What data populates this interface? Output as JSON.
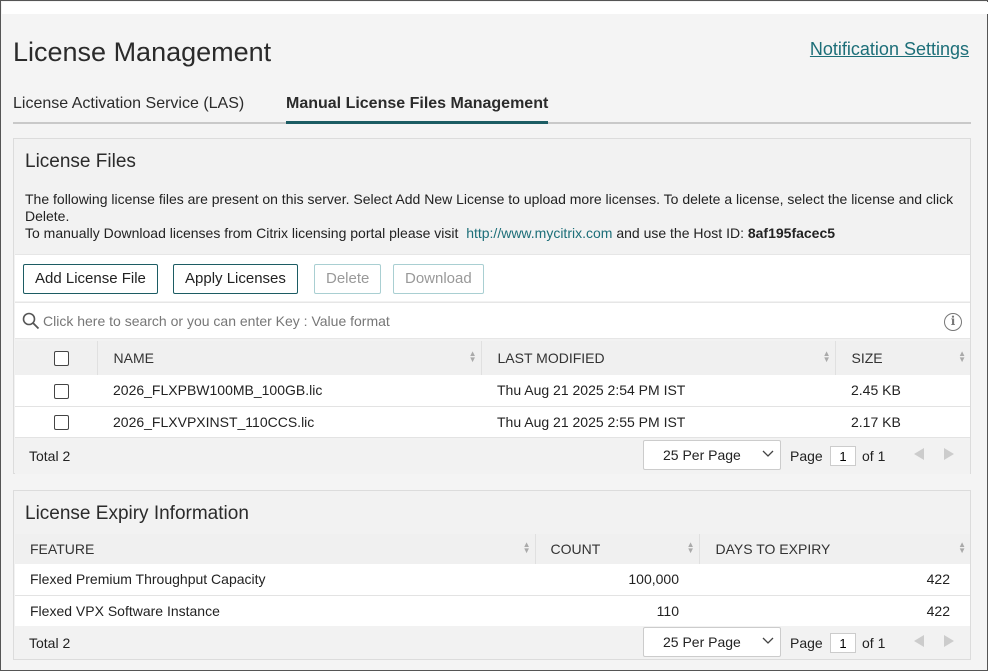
{
  "page": {
    "title": "License Management",
    "notification_link": "Notification Settings"
  },
  "tabs": [
    {
      "label": "License Activation Service (LAS)",
      "active": false
    },
    {
      "label": "Manual License Files Management",
      "active": true
    }
  ],
  "license_files": {
    "title": "License Files",
    "description_line1": "The following license files are present on this server. Select Add New License to upload more licenses. To delete a license, select the license and click Delete.",
    "description_line2_prefix": "To manually Download licenses from Citrix licensing portal please visit",
    "portal_link": "http://www.mycitrix.com",
    "description_line2_mid": "and use the Host ID:",
    "host_id": "8af195facec5",
    "buttons": {
      "add": "Add License File",
      "apply": "Apply Licenses",
      "delete": "Delete",
      "download": "Download"
    },
    "search_placeholder": "Click here to search or you can enter Key : Value format",
    "columns": [
      "NAME",
      "LAST MODIFIED",
      "SIZE"
    ],
    "rows": [
      {
        "name": "2026_FLXPBW100MB_100GB.lic",
        "modified": "Thu Aug 21 2025 2:54 PM IST",
        "size": "2.45 KB"
      },
      {
        "name": "2026_FLXVPXINST_110CCS.lic",
        "modified": "Thu Aug 21 2025 2:55 PM IST",
        "size": "2.17 KB"
      }
    ],
    "footer": {
      "total": "Total  2",
      "per_page": "25 Per Page",
      "page_label": "Page",
      "page_value": "1",
      "of_label": "of 1"
    }
  },
  "license_expiry": {
    "title": "License Expiry Information",
    "columns": [
      "FEATURE",
      "COUNT",
      "DAYS TO EXPIRY"
    ],
    "rows": [
      {
        "feature": "Flexed Premium Throughput Capacity",
        "count": "100,000",
        "days": "422"
      },
      {
        "feature": "Flexed VPX Software Instance",
        "count": "110",
        "days": "422"
      }
    ],
    "footer": {
      "total": "Total  2",
      "per_page": "25 Per Page",
      "page_label": "Page",
      "page_value": "1",
      "of_label": "of 1"
    }
  },
  "colors": {
    "accent": "#1c5c63",
    "link": "#1c6e78"
  },
  "icons": {
    "search": "search-icon",
    "info": "info-icon",
    "chevron": "chevron-down-icon",
    "prev": "prev-page-icon",
    "next": "next-page-icon"
  }
}
